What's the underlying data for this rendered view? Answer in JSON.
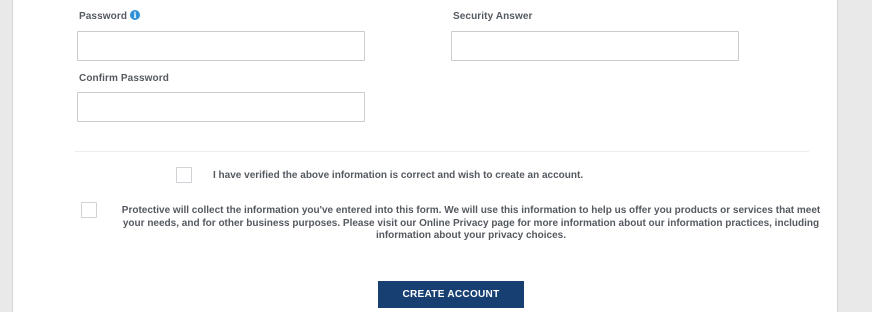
{
  "form": {
    "password": {
      "label": "Password",
      "value": "",
      "placeholder": ""
    },
    "security_answer": {
      "label": "Security Answer",
      "value": "",
      "placeholder": ""
    },
    "confirm_password": {
      "label": "Confirm Password",
      "value": "",
      "placeholder": ""
    },
    "verify_checkbox": {
      "label": "I have verified the above information is correct and wish to create an account.",
      "checked": false
    },
    "privacy_checkbox": {
      "label": "Protective will collect the information you've entered into this form. We will use this information to help us offer you products or services that meet your needs, and for other business purposes. Please visit our Online Privacy page for more information about our information practices, including information about your privacy choices.",
      "checked": false
    },
    "submit_label": "CREATE ACCOUNT"
  },
  "icons": {
    "password_info": "info-icon",
    "password_info_glyph": "i"
  },
  "colors": {
    "primary_button": "#173f72",
    "info_icon": "#2f8fd8",
    "label_text": "#555a60"
  }
}
